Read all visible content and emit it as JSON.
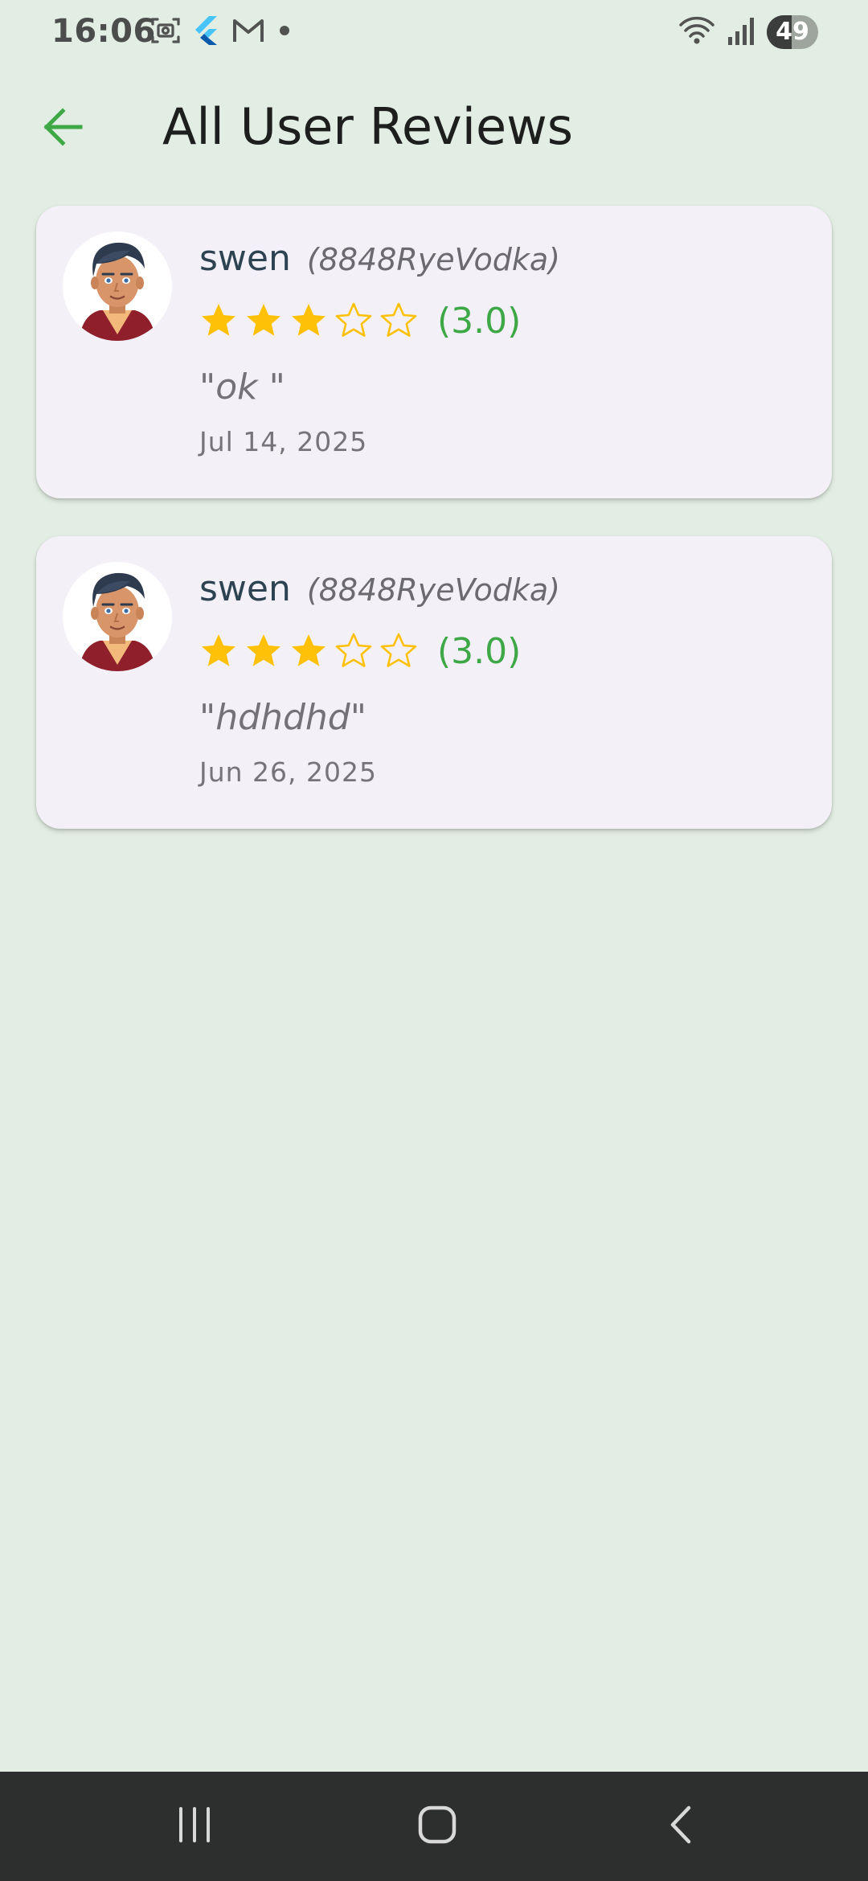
{
  "status_bar": {
    "time": "16:06",
    "battery": "49",
    "battery_level": 0.49,
    "left_icons": [
      "screenshot-icon",
      "flutter-icon",
      "gmail-icon",
      "dot-icon"
    ],
    "right_icons": [
      "wifi-icon",
      "signal-icon",
      "battery-icon"
    ]
  },
  "header": {
    "title": "All User Reviews",
    "back_icon": "arrow-left-icon"
  },
  "colors": {
    "background": "#e2ede3",
    "card": "#f4f0f8",
    "accent_green": "#3ea846",
    "star_gold": "#ffc107",
    "name": "#2d4352"
  },
  "reviews": [
    {
      "name": "swen",
      "handle": "(8848RyeVodka)",
      "rating": 3,
      "max_rating": 5,
      "rating_label": "(3.0)",
      "comment": "\"ok \"",
      "date": "Jul 14, 2025"
    },
    {
      "name": "swen",
      "handle": "(8848RyeVodka)",
      "rating": 3,
      "max_rating": 5,
      "rating_label": "(3.0)",
      "comment": "\"hdhdhd\"",
      "date": "Jun 26, 2025"
    }
  ],
  "nav_bar": {
    "buttons": [
      "recent-apps-icon",
      "home-icon",
      "back-icon"
    ]
  }
}
